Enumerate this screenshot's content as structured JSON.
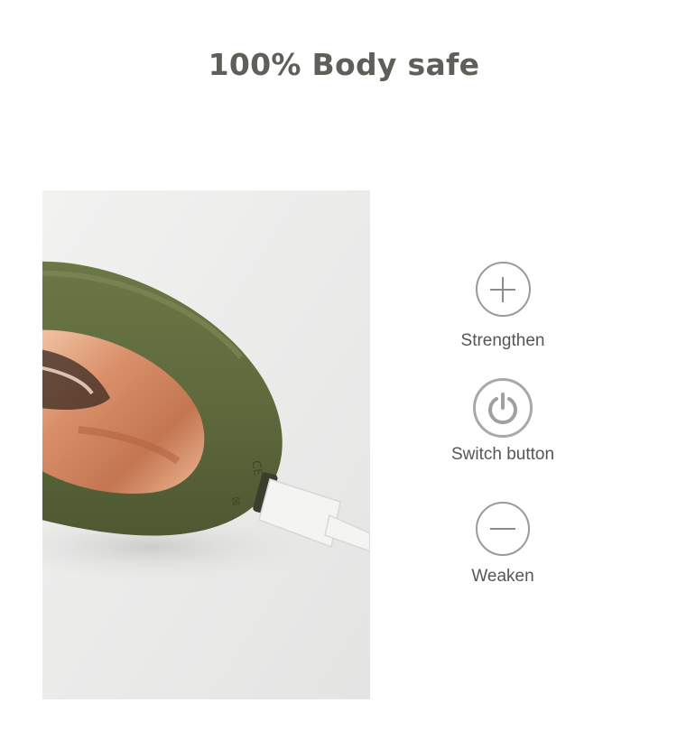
{
  "headline": "100% Body safe",
  "product_image": {
    "body_color": "#5f6a3d",
    "accent_color": "#d9906a",
    "cable_color": "#f4f4f2",
    "background_color": "#ececeb"
  },
  "controls": [
    {
      "icon": "plus-icon",
      "label": "Strengthen"
    },
    {
      "icon": "power-icon",
      "label": "Switch button"
    },
    {
      "icon": "minus-icon",
      "label": "Weaken"
    }
  ]
}
